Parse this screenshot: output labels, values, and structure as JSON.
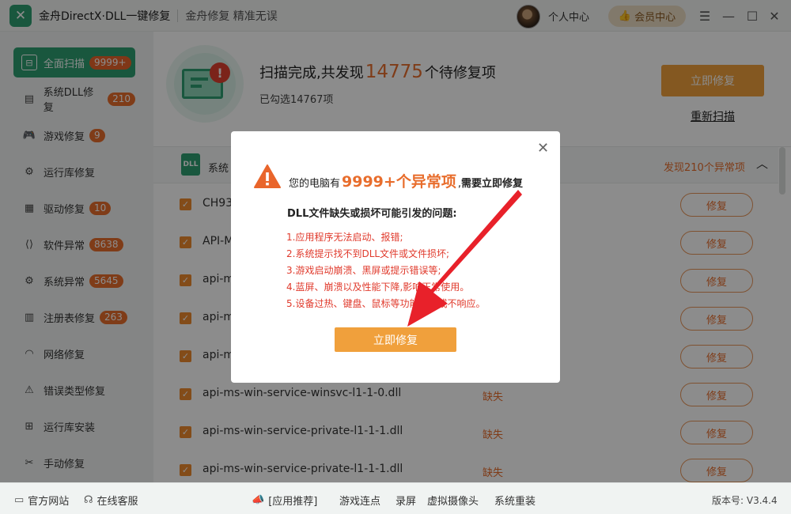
{
  "app": {
    "title": "金舟DirectX·DLL一键修复",
    "slogan": "金舟修复 精准无误",
    "user_center": "个人中心",
    "member_center": "会员中心"
  },
  "sidebar": {
    "items": [
      {
        "label": "全面扫描",
        "badge": "9999+",
        "icon": "scan-icon"
      },
      {
        "label": "系统DLL修复",
        "badge": "210",
        "icon": "dll-icon"
      },
      {
        "label": "游戏修复",
        "badge": "9",
        "icon": "gamepad-icon"
      },
      {
        "label": "运行库修复",
        "badge": "",
        "icon": "runtime-icon"
      },
      {
        "label": "驱动修复",
        "badge": "10",
        "icon": "driver-icon"
      },
      {
        "label": "软件异常",
        "badge": "8638",
        "icon": "code-icon"
      },
      {
        "label": "系统异常",
        "badge": "5645",
        "icon": "gear-icon"
      },
      {
        "label": "注册表修复",
        "badge": "263",
        "icon": "registry-icon"
      },
      {
        "label": "网络修复",
        "badge": "",
        "icon": "wifi-icon"
      },
      {
        "label": "错误类型修复",
        "badge": "",
        "icon": "warning-icon"
      },
      {
        "label": "运行库安装",
        "badge": "",
        "icon": "install-icon"
      },
      {
        "label": "手动修复",
        "badge": "",
        "icon": "wrench-icon"
      }
    ]
  },
  "scan": {
    "headline_prefix": "扫描完成,共发现",
    "count": "14775",
    "headline_suffix": "个待修复项",
    "selected": "已勾选14767项",
    "fix_now": "立即修复",
    "rescan": "重新扫描"
  },
  "category": {
    "name": "系统",
    "found": "发现210个异常项"
  },
  "rows": [
    {
      "name": "CH93",
      "status": "",
      "action": "修复"
    },
    {
      "name": "API-M",
      "status": "",
      "action": "修复"
    },
    {
      "name": "api-m",
      "status": "",
      "action": "修复"
    },
    {
      "name": "api-m",
      "status": "",
      "action": "修复"
    },
    {
      "name": "api-m",
      "status": "",
      "action": "修复"
    },
    {
      "name": "api-ms-win-service-winsvc-l1-1-0.dll",
      "status": "缺失",
      "action": "修复"
    },
    {
      "name": "api-ms-win-service-private-l1-1-1.dll",
      "status": "缺失",
      "action": "修复"
    },
    {
      "name": "api-ms-win-service-private-l1-1-1.dll",
      "status": "缺失",
      "action": "修复"
    }
  ],
  "modal": {
    "title_prefix": "您的电脑有",
    "count": "9999+个异常项",
    "title_suffix": ",",
    "title_bold": "需要立即修复",
    "subtitle": "DLL文件缺失或损坏可能引发的问题:",
    "issues": [
      "1.应用程序无法启动、报错;",
      "2.系统提示找不到DLL文件或文件损坏;",
      "3.游戏启动崩溃、黑屏或提示错误等;",
      "4.蓝屏、崩溃以及性能下降,影响正常使用。",
      "5.设备过热、键盘、鼠标等功能失常或不响应。"
    ],
    "button": "立即修复"
  },
  "footer": {
    "website": "官方网站",
    "support": "在线客服",
    "recommend": "[应用推荐]",
    "links": [
      "游戏连点",
      "录屏",
      "虚拟摄像头",
      "系统重装"
    ],
    "version": "版本号: V3.4.4"
  },
  "colors": {
    "brand_green": "#2f9e72",
    "accent_orange": "#f0a03c",
    "alert_red": "#e03a2c"
  }
}
